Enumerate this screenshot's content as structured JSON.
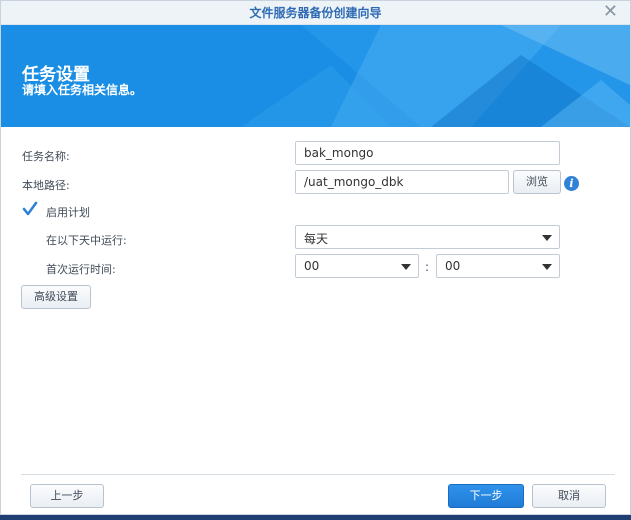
{
  "window": {
    "title": "文件服务器备份创建向导",
    "close_glyph": "✕"
  },
  "banner": {
    "title": "任务设置",
    "subtitle": "请填入任务相关信息。"
  },
  "form": {
    "task_name_label": "任务名称:",
    "task_name_value": "bak_mongo",
    "local_path_label": "本地路径:",
    "local_path_value": "/uat_mongo_dbk",
    "browse_label": "浏览",
    "info_glyph": "i",
    "enable_schedule_label": "启用计划",
    "enable_schedule_checked": true,
    "run_on_label": "在以下天中运行:",
    "run_on_value": "每天",
    "first_run_label": "首次运行时间:",
    "hour_value": "00",
    "time_separator": ":",
    "minute_value": "00",
    "advanced_label": "高级设置"
  },
  "footer": {
    "prev_label": "上一步",
    "next_label": "下一步",
    "cancel_label": "取消"
  },
  "colors": {
    "accent": "#1a8ee5",
    "primary_button": "#1f7bd7",
    "title_text": "#2f6bb3"
  }
}
